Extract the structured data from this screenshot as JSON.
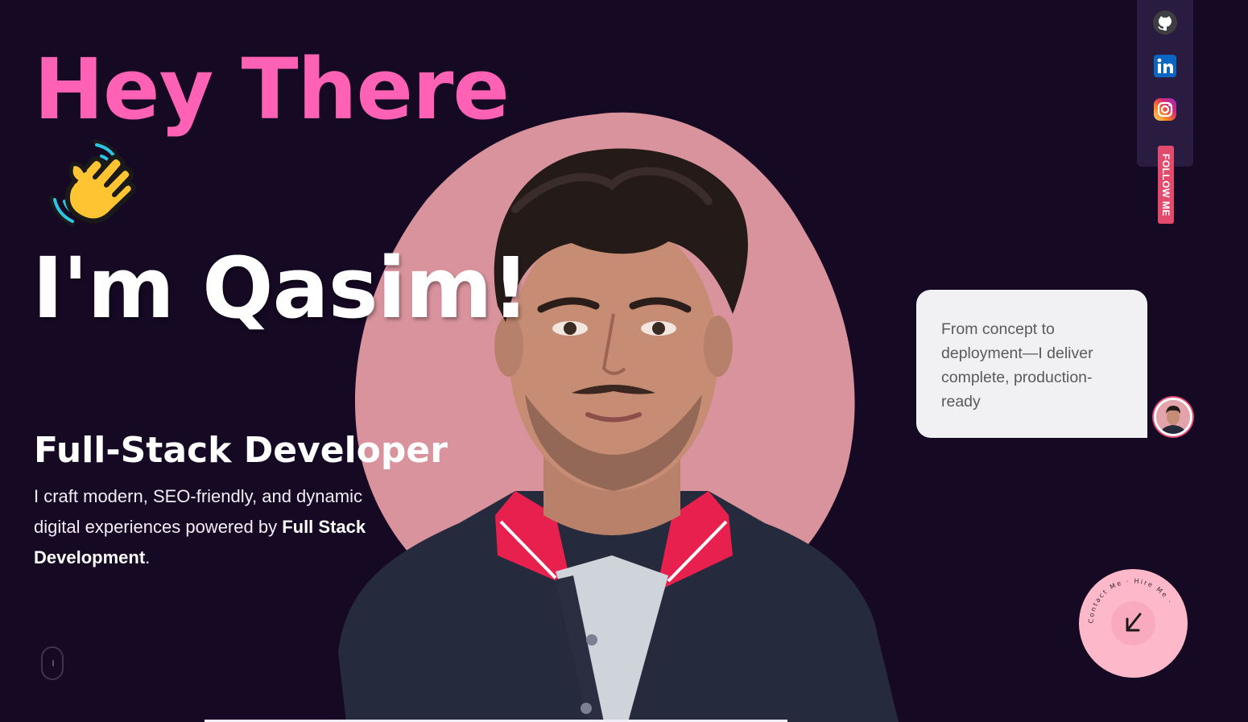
{
  "hero": {
    "greeting": "Hey There",
    "wave_emoji": "waving-hand-icon",
    "name": "I'm Qasim!",
    "role": "Full-Stack Developer",
    "description_prefix": "I craft modern, SEO-friendly, and dynamic digital experiences powered by ",
    "description_strong": "Full Stack Development",
    "description_suffix": "."
  },
  "social": {
    "items": [
      {
        "name": "github",
        "icon": "github-icon"
      },
      {
        "name": "linkedin",
        "icon": "linkedin-icon"
      },
      {
        "name": "instagram",
        "icon": "instagram-icon"
      }
    ],
    "follow_label": "FOLLOW ME"
  },
  "bubble": {
    "text": "From concept to deployment—I deliver complete, production-ready"
  },
  "contact_button": {
    "ring_text": "Contact Me · Hire Me ·",
    "icon": "arrow-down-left-icon"
  },
  "colors": {
    "background": "#160924",
    "accent_pink": "#ff62b4",
    "blob": "#d9939d",
    "rail": "#2a1c40",
    "follow_tag": "#e34b6c",
    "contact_circle": "#fdb8c9"
  }
}
